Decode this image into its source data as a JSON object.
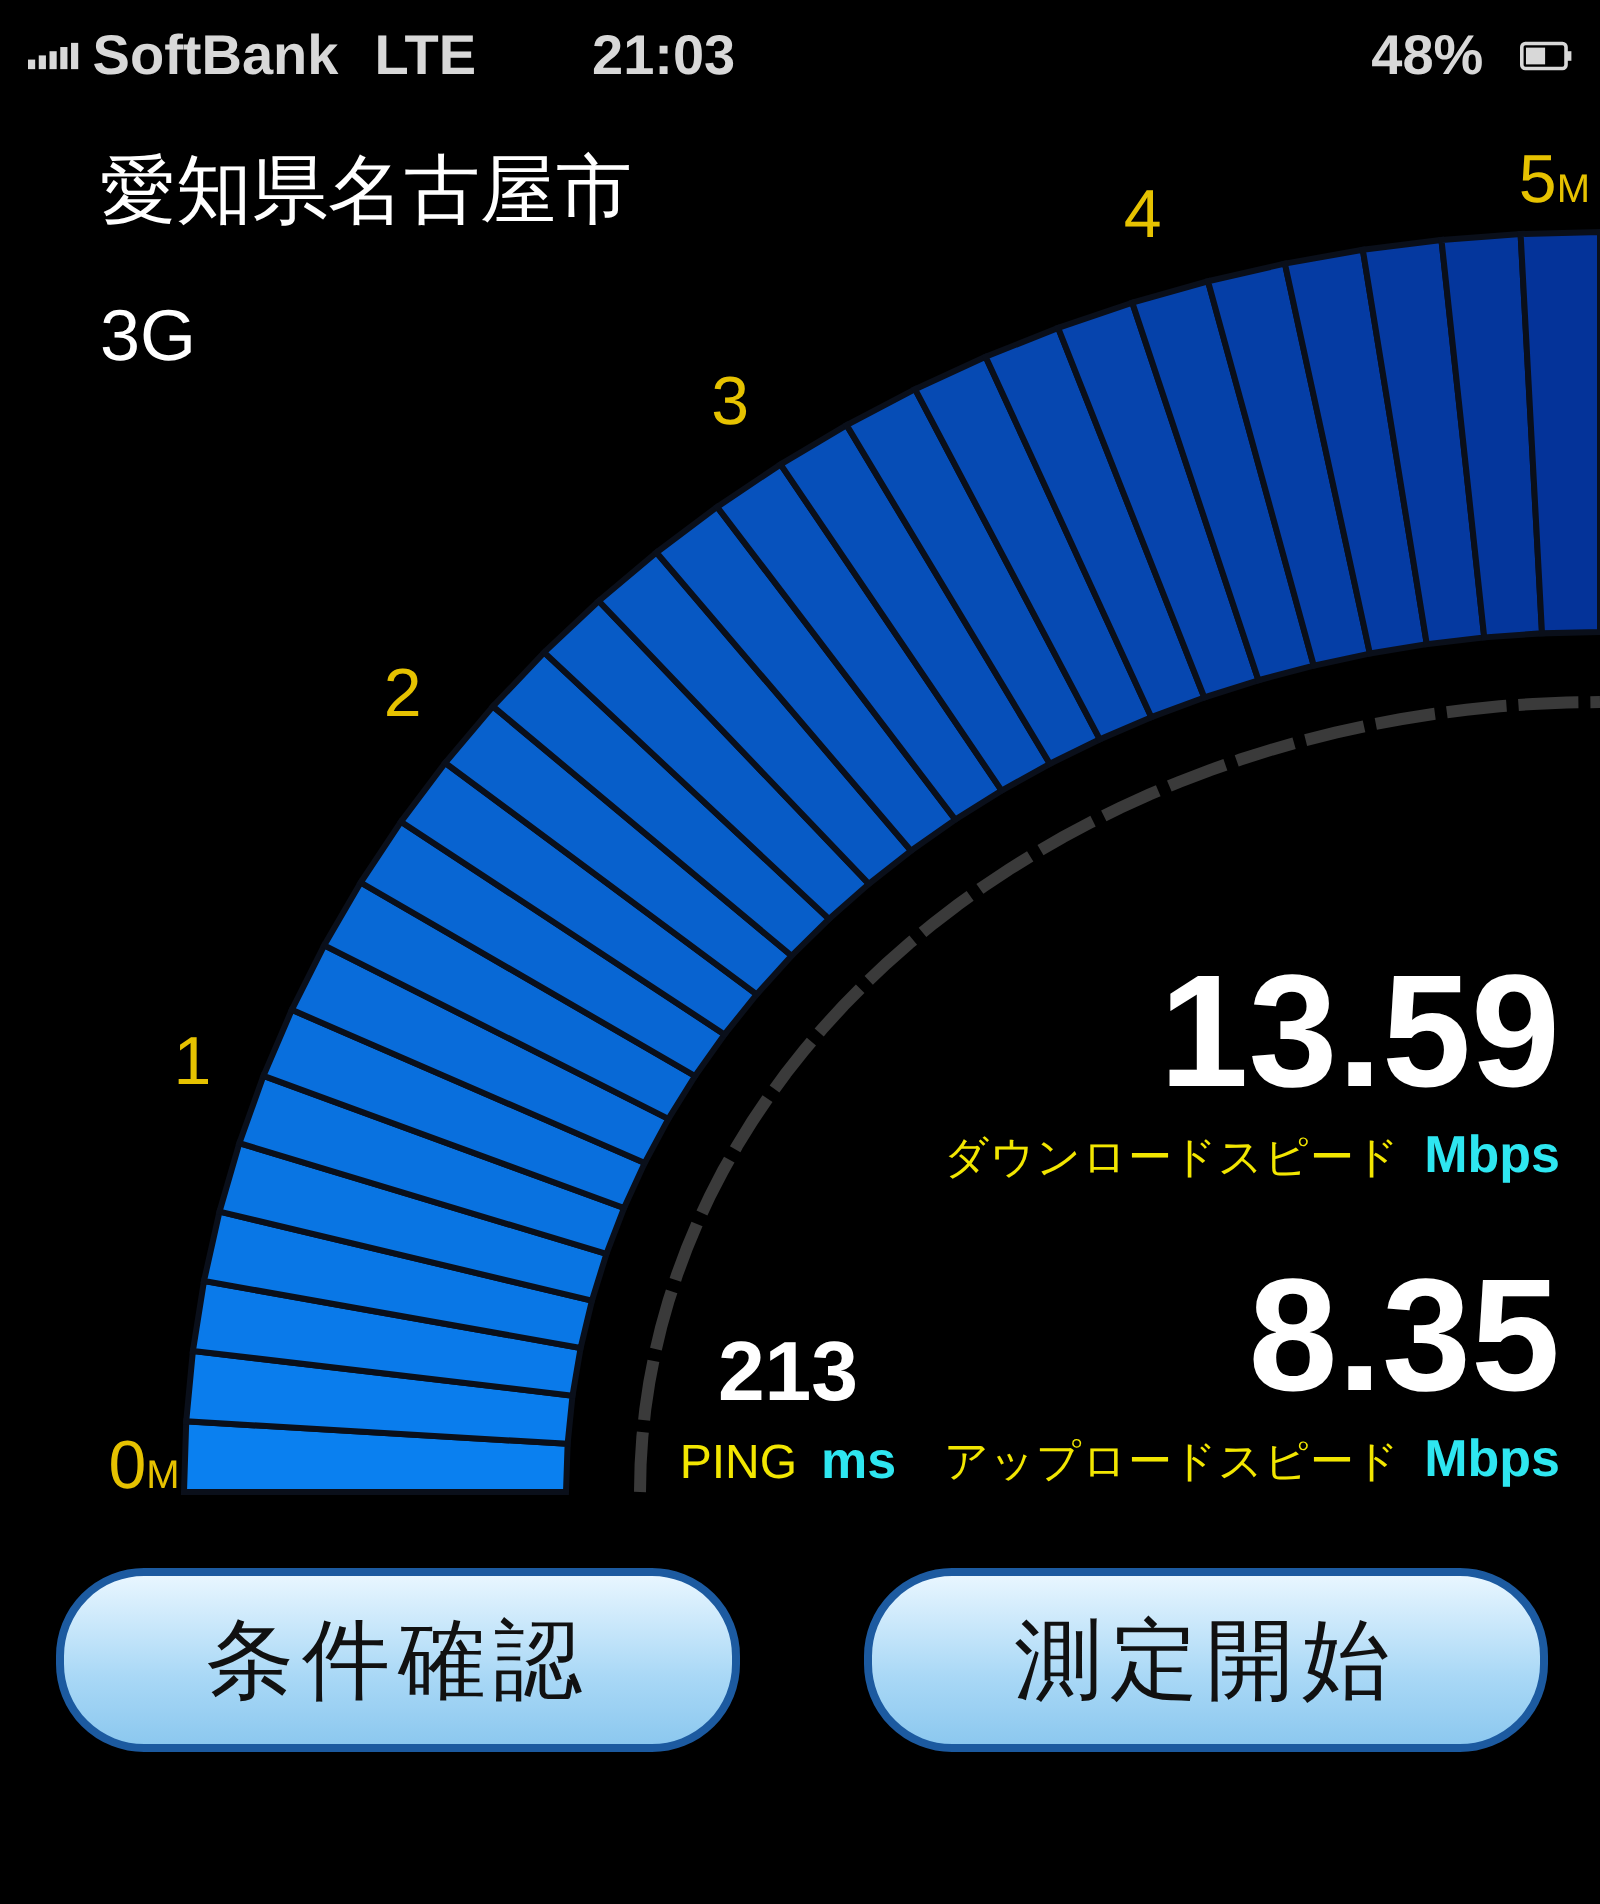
{
  "status_bar": {
    "carrier": "SoftBank",
    "network": "LTE",
    "time": "21:03",
    "battery": "48%"
  },
  "location": "愛知県名古屋市",
  "connection": "3G",
  "gauge": {
    "ticks": [
      {
        "label": "0",
        "unit": "M"
      },
      {
        "label": "1"
      },
      {
        "label": "2"
      },
      {
        "label": "3"
      },
      {
        "label": "4"
      },
      {
        "label": "5",
        "unit": "M"
      }
    ]
  },
  "ping": {
    "value": "213",
    "label": "PING",
    "unit": "ms"
  },
  "speeds": [
    {
      "value": "13.59",
      "label": "ダウンロードスピード",
      "unit": "Mbps"
    },
    {
      "value": "8.35",
      "label": "アップロードスピード",
      "unit": "Mbps"
    }
  ],
  "buttons": [
    "条件確認",
    "測定開始"
  ]
}
